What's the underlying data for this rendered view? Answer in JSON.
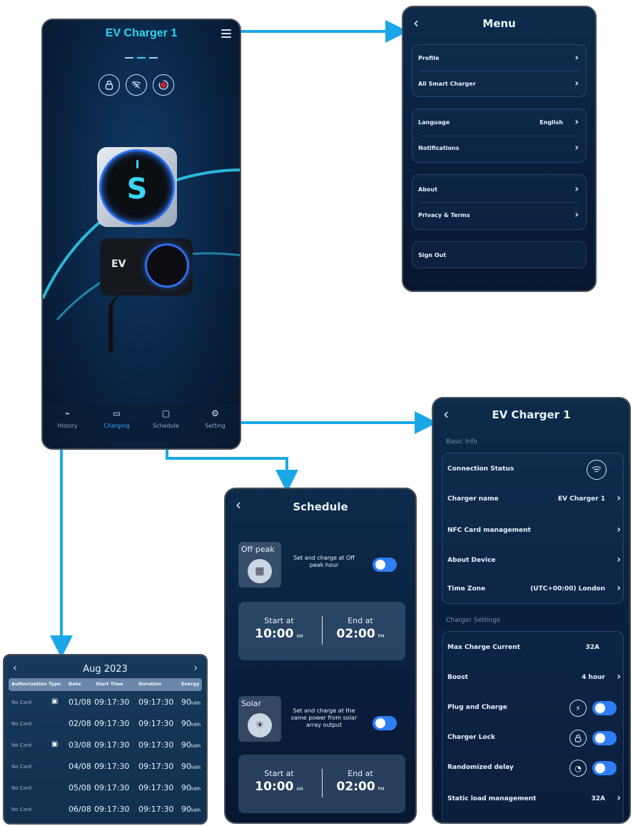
{
  "main": {
    "title": "EV Charger 1",
    "nav": [
      {
        "label": "History",
        "icon": "history-icon"
      },
      {
        "label": "Charging",
        "icon": "battery-icon"
      },
      {
        "label": "Schedule",
        "icon": "calendar-icon"
      },
      {
        "label": "Setting",
        "icon": "gear-icon"
      }
    ],
    "active_nav": "Charging",
    "charger_brand": "EV"
  },
  "menu": {
    "title": "Menu",
    "items": [
      {
        "label": "Profile"
      },
      {
        "label": "All Smart Charger"
      },
      {
        "label": "Language",
        "value": "English"
      },
      {
        "label": "Notifications"
      },
      {
        "label": "About"
      },
      {
        "label": "Privacy & Terms"
      },
      {
        "label": "Sign Out"
      }
    ]
  },
  "settings": {
    "title": "EV Charger 1",
    "basic_info_label": "Basic Info",
    "charger_settings_label": "Charger Settings",
    "basic": [
      {
        "label": "Connection Status"
      },
      {
        "label": "Charger name",
        "value": "EV Charger 1"
      },
      {
        "label": "NFC Card management"
      },
      {
        "label": "About Device"
      },
      {
        "label": "Time Zone",
        "value": "(UTC+00:00) London"
      }
    ],
    "charger": [
      {
        "label": "Max Charge Current",
        "value": "32A"
      },
      {
        "label": "Boost",
        "value": "4 hour"
      },
      {
        "label": "Plug and Charge",
        "toggle": true
      },
      {
        "label": "Charger Lock",
        "toggle": true
      },
      {
        "label": "Randomized delay",
        "toggle": true
      },
      {
        "label": "Static load management",
        "value": "32A"
      }
    ]
  },
  "schedule": {
    "title": "Schedule",
    "blocks": [
      {
        "mode": "Off peak",
        "description": "Set and charge at Off peak hour",
        "enabled": true,
        "start_label": "Start at",
        "start_time": "10:00",
        "start_ampm": "AM",
        "end_label": "End at",
        "end_time": "02:00",
        "end_ampm": "PM"
      },
      {
        "mode": "Solar",
        "description": "Set and charge at the same power from solar array output",
        "enabled": true,
        "start_label": "Start at",
        "start_time": "10:00",
        "start_ampm": "AM",
        "end_label": "End at",
        "end_time": "02:00",
        "end_ampm": "PM"
      }
    ]
  },
  "history": {
    "month": "Aug 2023",
    "columns": [
      "Authorization",
      "Type",
      "Date",
      "Start Time",
      "Duration",
      "Energy"
    ],
    "rows": [
      {
        "auth": "No Card",
        "type": "calendar",
        "date": "01/08",
        "start": "09:17:30",
        "duration": "09:17:30",
        "energy": "90",
        "unit": "kWh"
      },
      {
        "auth": "No Card",
        "type": "",
        "date": "02/08",
        "start": "09:17:30",
        "duration": "09:17:30",
        "energy": "90",
        "unit": "kWh"
      },
      {
        "auth": "No Card",
        "type": "calendar",
        "date": "03/08",
        "start": "09:17:30",
        "duration": "09:17:30",
        "energy": "90",
        "unit": "kWh"
      },
      {
        "auth": "No Card",
        "type": "",
        "date": "04/08",
        "start": "09:17:30",
        "duration": "09:17:30",
        "energy": "90",
        "unit": "kWh"
      },
      {
        "auth": "No Card",
        "type": "",
        "date": "05/08",
        "start": "09:17:30",
        "duration": "09:17:30",
        "energy": "90",
        "unit": "kWh"
      },
      {
        "auth": "No Card",
        "type": "",
        "date": "06/08",
        "start": "09:17:30",
        "duration": "09:17:30",
        "energy": "90",
        "unit": "kWh"
      }
    ]
  },
  "colors": {
    "accent": "#2fd3f5",
    "toggle": "#2f7df5",
    "arrow": "#1aa7e8"
  }
}
